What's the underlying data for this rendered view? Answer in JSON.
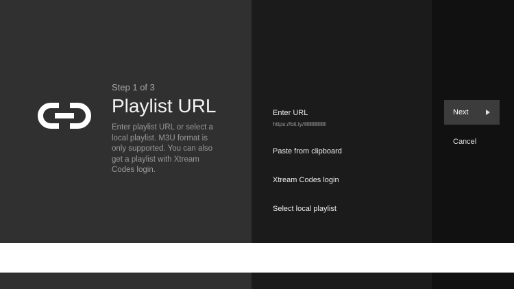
{
  "header": {
    "step": "Step 1 of 3",
    "title": "Playlist URL",
    "description": "Enter playlist URL or select a local playlist. M3U format is only supported. You can also get a playlist with Xtream Codes login."
  },
  "header_icon": "link-icon",
  "options": [
    {
      "label": "Enter URL",
      "value": "https://bit.ly/"
    },
    {
      "label": "Paste from clipboard"
    },
    {
      "label": "Xtream Codes login"
    },
    {
      "label": "Select local playlist"
    }
  ],
  "actions": {
    "next_label": "Next",
    "next_icon": "play-arrow-icon",
    "cancel_label": "Cancel"
  },
  "colors": {
    "left_panel": "#303030",
    "middle_panel": "#1b1b1b",
    "right_panel": "#111111",
    "selected_button": "#3c3c3c"
  }
}
